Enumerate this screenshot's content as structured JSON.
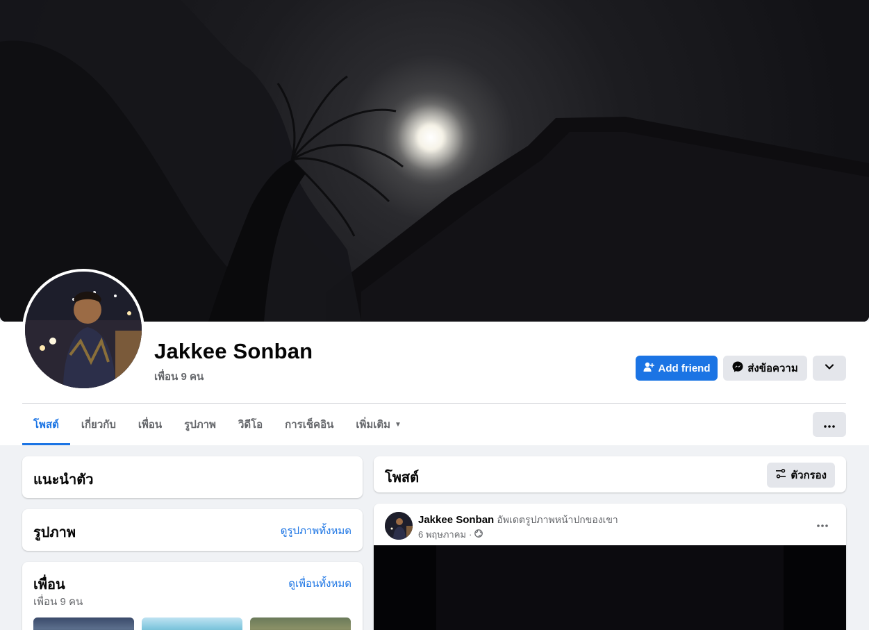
{
  "profile": {
    "name": "Jakkee Sonban",
    "friend_count": "เพื่อน 9 คน"
  },
  "actions": {
    "add_friend": "Add friend",
    "message": "ส่งข้อความ"
  },
  "tabs": [
    {
      "label": "โพสต์"
    },
    {
      "label": "เกี่ยวกับ"
    },
    {
      "label": "เพื่อน"
    },
    {
      "label": "รูปภาพ"
    },
    {
      "label": "วิดีโอ"
    },
    {
      "label": "การเช็คอิน"
    },
    {
      "label": "เพิ่มเติม"
    }
  ],
  "intro": {
    "title": "แนะนำตัว"
  },
  "photos": {
    "title": "รูปภาพ",
    "link": "ดูรูปภาพทั้งหมด"
  },
  "friends": {
    "title": "เพื่อน",
    "link": "ดูเพื่อนทั้งหมด",
    "count": "เพื่อน 9 คน"
  },
  "posts": {
    "title": "โพสต์",
    "filter": "ตัวกรอง"
  },
  "post": {
    "author": "Jakkee Sonban",
    "action": "อัพเดตรูปภาพหน้าปกของเขา",
    "date": "6 พฤษภาคม",
    "separator": "·",
    "privacy_icon": "globe-icon"
  },
  "colors": {
    "accent": "#1b74e4",
    "secondary_button": "#e4e6eb",
    "page_background": "#f0f2f5"
  }
}
